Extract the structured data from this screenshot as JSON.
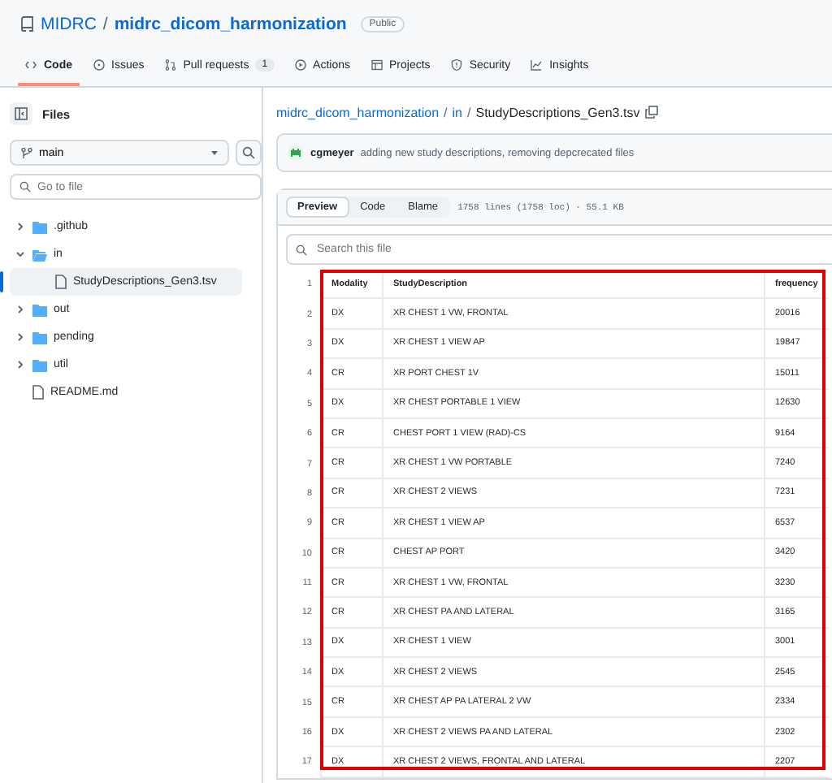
{
  "repo": {
    "owner": "MIDRC",
    "separator": "/",
    "name": "midrc_dicom_harmonization",
    "visibility": "Public"
  },
  "tabs": [
    {
      "label": "Code",
      "selected": true
    },
    {
      "label": "Issues",
      "selected": false
    },
    {
      "label": "Pull requests",
      "counter": "1",
      "selected": false
    },
    {
      "label": "Actions",
      "selected": false
    },
    {
      "label": "Projects",
      "selected": false
    },
    {
      "label": "Security",
      "selected": false
    },
    {
      "label": "Insights",
      "selected": false
    }
  ],
  "sidebar": {
    "title": "Files",
    "branch": "main",
    "search_placeholder": "Go to file",
    "tree": [
      {
        "name": ".github",
        "kind": "folder",
        "expanded": false
      },
      {
        "name": "in",
        "kind": "folder",
        "expanded": true,
        "children": [
          {
            "name": "StudyDescriptions_Gen3.tsv",
            "kind": "file",
            "selected": true
          }
        ]
      },
      {
        "name": "out",
        "kind": "folder",
        "expanded": false
      },
      {
        "name": "pending",
        "kind": "folder",
        "expanded": false
      },
      {
        "name": "util",
        "kind": "folder",
        "expanded": false
      },
      {
        "name": "README.md",
        "kind": "file",
        "selected": false
      }
    ]
  },
  "breadcrumb": [
    {
      "label": "midrc_dicom_harmonization",
      "kind": "link"
    },
    {
      "label": "/",
      "kind": "sep"
    },
    {
      "label": "in",
      "kind": "link"
    },
    {
      "label": "/",
      "kind": "sep"
    },
    {
      "label": "StudyDescriptions_Gen3.tsv",
      "kind": "current"
    }
  ],
  "commit": {
    "author": "cgmeyer",
    "message": "adding new study descriptions, removing depcrecated files"
  },
  "view_tabs": [
    {
      "label": "Preview",
      "selected": true
    },
    {
      "label": "Code",
      "selected": false
    },
    {
      "label": "Blame",
      "selected": false
    }
  ],
  "file_info": "1758 lines (1758 loc) · 55.1 KB",
  "file_search_placeholder": "Search this file",
  "table": {
    "rows": [
      {
        "line": "1",
        "cells": [
          "Modality",
          "StudyDescription",
          "frequency"
        ]
      },
      {
        "line": "2",
        "cells": [
          "DX",
          "XR CHEST 1 VW, FRONTAL",
          "20016"
        ]
      },
      {
        "line": "3",
        "cells": [
          "DX",
          "XR CHEST 1 VIEW AP",
          "19847"
        ]
      },
      {
        "line": "4",
        "cells": [
          "CR",
          "XR PORT CHEST 1V",
          "15011"
        ]
      },
      {
        "line": "5",
        "cells": [
          "DX",
          "XR CHEST PORTABLE 1 VIEW",
          "12630"
        ]
      },
      {
        "line": "6",
        "cells": [
          "CR",
          "CHEST PORT 1 VIEW (RAD)-CS",
          "9164"
        ]
      },
      {
        "line": "7",
        "cells": [
          "CR",
          "XR CHEST 1 VW PORTABLE",
          "7240"
        ]
      },
      {
        "line": "8",
        "cells": [
          "CR",
          "XR CHEST 2 VIEWS",
          "7231"
        ]
      },
      {
        "line": "9",
        "cells": [
          "CR",
          "XR CHEST 1 VIEW AP",
          "6537"
        ]
      },
      {
        "line": "10",
        "cells": [
          "CR",
          "CHEST AP PORT",
          "3420"
        ]
      },
      {
        "line": "11",
        "cells": [
          "CR",
          "XR CHEST 1 VW, FRONTAL",
          "3230"
        ]
      },
      {
        "line": "12",
        "cells": [
          "CR",
          "XR CHEST PA AND LATERAL",
          "3165"
        ]
      },
      {
        "line": "13",
        "cells": [
          "DX",
          "XR CHEST 1 VIEW",
          "3001"
        ]
      },
      {
        "line": "14",
        "cells": [
          "DX",
          "XR CHEST 2 VIEWS",
          "2545"
        ]
      },
      {
        "line": "15",
        "cells": [
          "CR",
          "XR CHEST AP PA LATERAL 2 VW",
          "2334"
        ]
      },
      {
        "line": "16",
        "cells": [
          "DX",
          "XR CHEST 2 VIEWS PA AND LATERAL",
          "2302"
        ]
      },
      {
        "line": "17",
        "cells": [
          "DX",
          "XR CHEST 2 VIEWS, FRONTAL AND LATERAL",
          "2207"
        ]
      }
    ]
  }
}
